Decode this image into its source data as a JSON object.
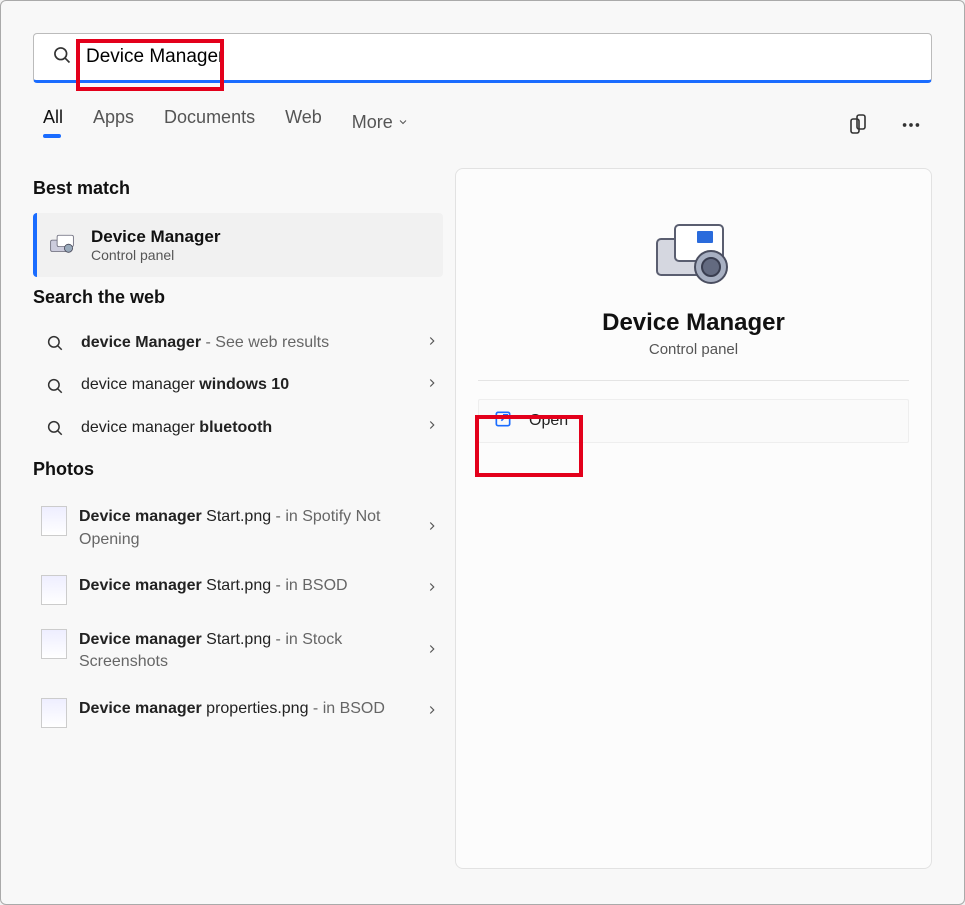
{
  "search": {
    "value": "Device Manager"
  },
  "tabs": {
    "items": [
      {
        "label": "All",
        "active": true
      },
      {
        "label": "Apps"
      },
      {
        "label": "Documents"
      },
      {
        "label": "Web"
      }
    ],
    "more_label": "More"
  },
  "sections": {
    "best_match_heading": "Best match",
    "web_heading": "Search the web",
    "photos_heading": "Photos"
  },
  "best_match": {
    "title": "Device Manager",
    "subtitle": "Control panel"
  },
  "web_results": [
    {
      "prefix": "",
      "bold": "device Manager",
      "suffix": " - See web results"
    },
    {
      "prefix": "device manager ",
      "bold": "windows 10",
      "suffix": ""
    },
    {
      "prefix": "device manager ",
      "bold": "bluetooth",
      "suffix": ""
    }
  ],
  "photos": [
    {
      "name_bold": "Device manager",
      "name_rest": " Start.png",
      "loc": " - in Spotify Not Opening"
    },
    {
      "name_bold": "Device manager",
      "name_rest": " Start.png",
      "loc": " - in BSOD"
    },
    {
      "name_bold": "Device manager",
      "name_rest": " Start.png",
      "loc": " - in Stock Screenshots"
    },
    {
      "name_bold": "Device manager",
      "name_rest": " properties.png",
      "loc": " - in BSOD"
    }
  ],
  "preview": {
    "title": "Device Manager",
    "subtitle": "Control panel",
    "open_label": "Open"
  }
}
